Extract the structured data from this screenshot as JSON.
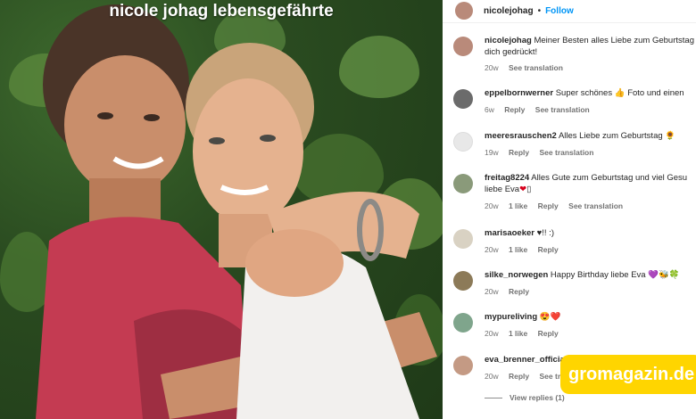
{
  "photo": {
    "caption": "nicole johag lebensgefährte"
  },
  "post": {
    "username": "nicolejohag",
    "dot": "•",
    "follow": "Follow"
  },
  "comments": [
    {
      "user": "nicolejohag",
      "text": "Meiner Besten alles Liebe zum Geburtstag",
      "text2": "dich gedrückt!",
      "age": "20w",
      "likes": "",
      "reply": "",
      "translation": "See translation",
      "avatar_color": "#b98a7a"
    },
    {
      "user": "eppelbornwerner",
      "text": "Super schönes 👍 Foto und einen",
      "text2": "",
      "age": "6w",
      "likes": "",
      "reply": "Reply",
      "translation": "See translation",
      "avatar_color": "#6b6b6b"
    },
    {
      "user": "meeresrauschen2",
      "text": "Alles Liebe zum Geburtstag 🌻",
      "text2": "",
      "age": "19w",
      "likes": "",
      "reply": "Reply",
      "translation": "See translation",
      "avatar_color": "#e8e8e8"
    },
    {
      "user": "freitag8224",
      "text": "Alles Gute zum Geburtstag und viel Gesu",
      "text2": "liebe Eva",
      "age": "20w",
      "likes": "1 like",
      "reply": "Reply",
      "translation": "See translation",
      "avatar_color": "#8a9a7a"
    },
    {
      "user": "marisaoeker",
      "text": "♥!! :)",
      "text2": "",
      "age": "20w",
      "likes": "1 like",
      "reply": "Reply",
      "translation": "",
      "avatar_color": "#d9d2c3"
    },
    {
      "user": "silke_norwegen",
      "text": "Happy Birthday liebe Eva 💜🐝🍀",
      "text2": "",
      "age": "20w",
      "likes": "",
      "reply": "Reply",
      "translation": "",
      "avatar_color": "#8c7a58"
    },
    {
      "user": "mypureliving",
      "text": "😍❤️",
      "text2": "",
      "age": "20w",
      "likes": "1 like",
      "reply": "Reply",
      "translation": "",
      "avatar_color": "#7fa58c"
    },
    {
      "user": "eva_brenner_official",
      "text": "",
      "text2": "",
      "age": "20w",
      "likes": "",
      "reply": "Reply",
      "translation": "See tra",
      "avatar_color": "#c49a84"
    }
  ],
  "view_replies": "View replies (1)",
  "watermark": "gromagazin.de"
}
